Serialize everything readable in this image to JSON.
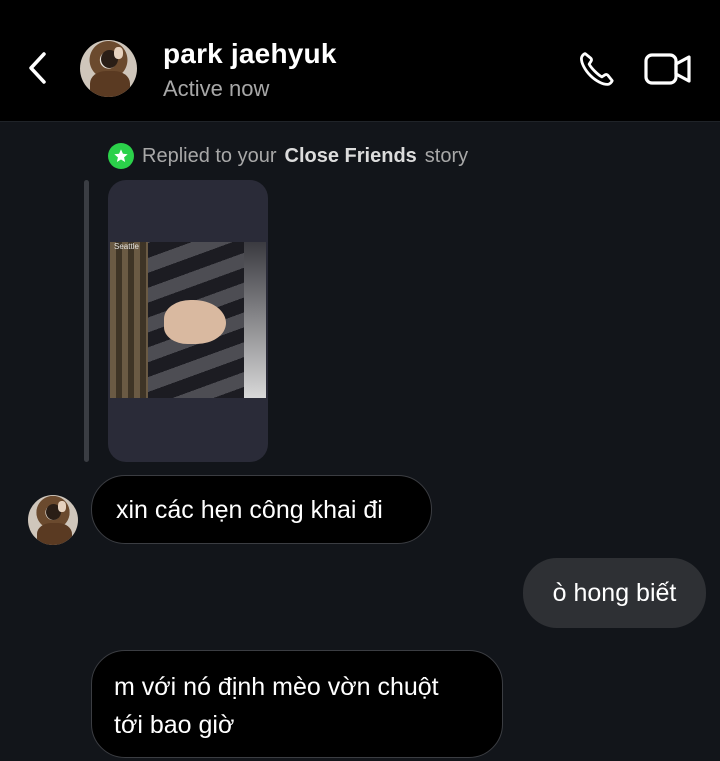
{
  "header": {
    "contact_name": "park jaehyuk",
    "status": "Active now",
    "icons": [
      "chevron-left-icon",
      "avatar",
      "phone-icon",
      "video-camera-icon"
    ]
  },
  "story_reply": {
    "prefix": "Replied to your",
    "emphasis": "Close Friends",
    "suffix": "story",
    "badge_color": "#2bd14a",
    "photo_tag": "Seattle"
  },
  "messages": [
    {
      "side": "incoming",
      "lines": [
        "xin các hẹn công khai đi"
      ]
    },
    {
      "side": "outgoing",
      "lines": [
        "ò hong biết"
      ]
    },
    {
      "side": "incoming",
      "lines": [
        "m với nó định mèo vờn chuột",
        "tới bao giờ"
      ]
    }
  ]
}
